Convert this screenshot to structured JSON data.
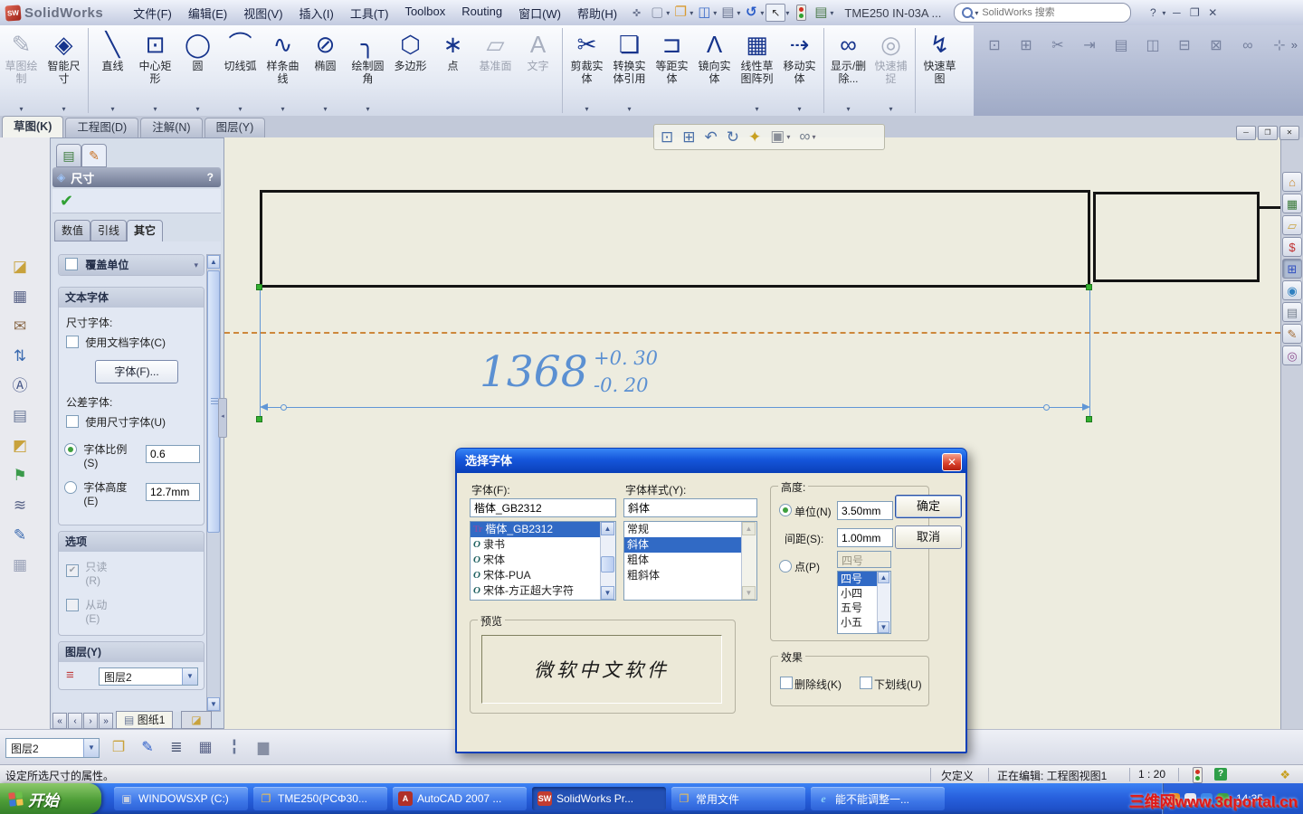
{
  "titlebar": {
    "logo_text": "SolidWorks",
    "menus": [
      "文件(F)",
      "编辑(E)",
      "视图(V)",
      "插入(I)",
      "工具(T)",
      "Toolbox",
      "Routing",
      "窗口(W)",
      "帮助(H)"
    ],
    "doc_title": "TME250 IN-03A ...",
    "search_placeholder": "SolidWorks 搜索",
    "help_label": "?"
  },
  "quickbar": {
    "new": "▢",
    "open": "❐",
    "save": "◫",
    "print": "▤",
    "undo": "↺",
    "select": "↖",
    "list": "▤"
  },
  "window_controls": {
    "minimize": "─",
    "restore": "❐",
    "close": "✕"
  },
  "toolbar": {
    "items": [
      {
        "label": "草图绘制",
        "glyph": "✎",
        "icon": "sketch-button",
        "disabled": true,
        "dd": true
      },
      {
        "label": "智能尺寸",
        "glyph": "◈",
        "icon": "smart-dimension-button",
        "dd": true
      },
      {
        "sep": true
      },
      {
        "label": "直线",
        "glyph": "╲",
        "icon": "line-button",
        "dd": true
      },
      {
        "label": "中心矩形",
        "glyph": "⊡",
        "icon": "center-rectangle-button",
        "dd": true
      },
      {
        "label": "圆",
        "glyph": "◯",
        "icon": "circle-button",
        "dd": true
      },
      {
        "label": "切线弧",
        "glyph": "⌒",
        "icon": "tangent-arc-button",
        "dd": true
      },
      {
        "label": "样条曲线",
        "glyph": "∿",
        "icon": "spline-button",
        "dd": true
      },
      {
        "label": "椭圆",
        "glyph": "⊘",
        "icon": "ellipse-button",
        "dd": true
      },
      {
        "label": "绘制圆角",
        "glyph": "╮",
        "icon": "sketch-fillet-button",
        "dd": true
      },
      {
        "label": "多边形",
        "glyph": "⬡",
        "icon": "polygon-button"
      },
      {
        "label": "点",
        "glyph": "∗",
        "icon": "point-button"
      },
      {
        "label": "基准面",
        "glyph": "▱",
        "icon": "plane-button",
        "disabled": true
      },
      {
        "label": "文字",
        "glyph": "A",
        "icon": "text-button",
        "disabled": true
      },
      {
        "sep": true
      },
      {
        "label": "剪裁实体",
        "glyph": "✂",
        "icon": "trim-entities-button",
        "dd": true
      },
      {
        "label": "转换实体引用",
        "glyph": "❏",
        "icon": "convert-entities-button",
        "dd": true
      },
      {
        "label": "等距实体",
        "glyph": "⊐",
        "icon": "offset-entities-button"
      },
      {
        "label": "镜向实体",
        "glyph": "Λ",
        "icon": "mirror-entities-button"
      },
      {
        "label": "线性草图阵列",
        "glyph": "▦",
        "icon": "linear-sketch-pattern-button",
        "dd": true
      },
      {
        "label": "移动实体",
        "glyph": "⇢",
        "icon": "move-entities-button",
        "dd": true
      },
      {
        "sep": true
      },
      {
        "label": "显示/删除...",
        "glyph": "∞",
        "icon": "display-delete-relations-button",
        "dd": true
      },
      {
        "label": "快速捕捉",
        "glyph": "◎",
        "icon": "quick-snaps-button",
        "disabled": true,
        "dd": true
      },
      {
        "sep": true
      },
      {
        "label": "快速草图",
        "glyph": "↯",
        "icon": "rapid-sketch-button",
        "color": "#C8A020"
      }
    ]
  },
  "toolbar_ext": {
    "icons": [
      {
        "glyph": "⊡",
        "name": "ext-tool-icon-1"
      },
      {
        "glyph": "⊞",
        "name": "ext-tool-icon-2"
      },
      {
        "glyph": "✂",
        "name": "ext-tool-icon-3"
      },
      {
        "glyph": "⇥",
        "name": "ext-tool-icon-4"
      },
      {
        "glyph": "▤",
        "name": "ext-tool-icon-5"
      },
      {
        "glyph": "◫",
        "name": "ext-tool-icon-6"
      },
      {
        "glyph": "⊟",
        "name": "ext-tool-icon-7"
      },
      {
        "glyph": "⊠",
        "name": "ext-tool-icon-8"
      },
      {
        "glyph": "∞",
        "name": "ext-tool-icon-9"
      },
      {
        "glyph": "⊹",
        "name": "ext-tool-icon-10"
      }
    ],
    "more": "»"
  },
  "doc_tabs": [
    {
      "label": "草图(K)",
      "active": true,
      "name": "tab-sketch"
    },
    {
      "label": "工程图(D)",
      "name": "tab-drawing"
    },
    {
      "label": "注解(N)",
      "name": "tab-annotation"
    },
    {
      "label": "图层(Y)",
      "name": "tab-layer"
    }
  ],
  "left_strip": {
    "icons": [
      {
        "glyph": "◪",
        "name": "sketch-color-icon",
        "color": "#C8A23C"
      },
      {
        "glyph": "▦",
        "name": "grid-icon",
        "color": "#5A6488"
      },
      {
        "glyph": "✉",
        "name": "stamp-icon",
        "color": "#8A6A4A"
      },
      {
        "glyph": "⇅",
        "name": "reverse-direction-icon",
        "color": "#3A6AB0"
      },
      {
        "glyph": "Ⓐ",
        "name": "spell-check-icon",
        "color": "#4A5A8A"
      },
      {
        "glyph": "▤",
        "name": "table-icon",
        "color": "#6A7898"
      },
      {
        "glyph": "◩",
        "name": "block-icon",
        "color": "#C8A23C"
      },
      {
        "glyph": "⚑",
        "name": "flag-icon",
        "color": "#3A9A4A"
      },
      {
        "glyph": "≋",
        "name": "spring-icon",
        "color": "#5A6488"
      },
      {
        "glyph": "✎",
        "name": "pen-icon",
        "color": "#3A6AB0"
      },
      {
        "glyph": "▦",
        "name": "pattern-icon",
        "color": "#9AA2B8"
      }
    ]
  },
  "panel": {
    "title": "尺寸",
    "help": "?",
    "tabs": [
      {
        "label": "数值",
        "name": "panel-tab-value"
      },
      {
        "label": "引线",
        "name": "panel-tab-leaders"
      },
      {
        "label": "其它",
        "active": true,
        "name": "panel-tab-other"
      }
    ],
    "override_units": "覆盖单位",
    "text_font_header": "文本字体",
    "dim_font_label": "尺寸字体:",
    "use_doc_font": "使用文档字体(C)",
    "font_button": "字体(F)...",
    "tol_font_label": "公差字体:",
    "use_dim_font": "使用尺寸字体(U)",
    "font_scale_label": "字体比例",
    "font_scale_key": "(S)",
    "font_scale_value": "0.6",
    "font_height_label": "字体高度",
    "font_height_key": "(E)",
    "font_height_value": "12.7mm",
    "options_header": "选项",
    "readonly_label": "只读",
    "readonly_key": "(R)",
    "driven_label": "从动",
    "driven_key": "(E)",
    "layer_header": "图层(Y)",
    "layer_value": "图层2"
  },
  "sheet": {
    "nav": [
      "«",
      "‹",
      "›",
      "»"
    ],
    "tab": "图纸1"
  },
  "drawing": {
    "dim": "1368",
    "tol_plus": "+0. 30",
    "tol_minus": "-0. 20"
  },
  "headsup": {
    "icons": [
      {
        "glyph": "⊡",
        "name": "zoom-fit-icon",
        "color": "#4A6FA8"
      },
      {
        "glyph": "⊞",
        "name": "zoom-area-icon",
        "color": "#4A6FA8"
      },
      {
        "glyph": "↶",
        "name": "previous-view-icon",
        "color": "#4A6FA8"
      },
      {
        "glyph": "↻",
        "name": "rotate-view-icon",
        "color": "#4A6FA8"
      },
      {
        "glyph": "✦",
        "name": "3d-drawing-view-icon",
        "color": "#C8A020"
      },
      {
        "glyph": "▣",
        "name": "display-style-icon",
        "color": "#8A8F98",
        "dd": true
      },
      {
        "glyph": "∞",
        "name": "hide-show-items-icon",
        "color": "#77818F",
        "dd": true
      }
    ]
  },
  "right_pane": {
    "icons": [
      {
        "glyph": "⌂",
        "name": "home-icon",
        "color": "#C8862B"
      },
      {
        "glyph": "▦",
        "name": "resources-icon",
        "color": "#3A7A3A"
      },
      {
        "glyph": "▱",
        "name": "design-library-icon",
        "color": "#C8A23C"
      },
      {
        "glyph": "$",
        "name": "toolbox-icon",
        "color": "#C03030"
      },
      {
        "glyph": "⊞",
        "name": "file-explorer-icon",
        "color": "#3050C0",
        "active": true
      },
      {
        "glyph": "◉",
        "name": "internet-icon",
        "color": "#3080C0"
      },
      {
        "glyph": "▤",
        "name": "document-icon",
        "color": "#77818F"
      },
      {
        "glyph": "✎",
        "name": "custom-properties-icon",
        "color": "#A06830"
      },
      {
        "glyph": "◎",
        "name": "search-icon",
        "color": "#905090"
      }
    ]
  },
  "dialog": {
    "title": "选择字体",
    "font_label": "字体(F):",
    "font_value": "楷体_GB2312",
    "fonts": [
      {
        "name": "楷体_GB2312",
        "type": "TT",
        "selected": true
      },
      {
        "name": "隶书",
        "type": "O"
      },
      {
        "name": "宋体",
        "type": "O"
      },
      {
        "name": "宋体-PUA",
        "type": "O"
      },
      {
        "name": "宋体-方正超大字符",
        "type": "O"
      }
    ],
    "style_label": "字体样式(Y):",
    "style_value": "斜体",
    "styles": [
      {
        "name": "常规"
      },
      {
        "name": "斜体",
        "selected": true
      },
      {
        "name": "粗体"
      },
      {
        "name": "粗斜体"
      }
    ],
    "height_group": "高度:",
    "units_label": "单位(N)",
    "units_value": "3.50mm",
    "spacing_label": "间距(S):",
    "spacing_value": "1.00mm",
    "points_label": "点(P)",
    "points_value": "四号",
    "sizes": [
      {
        "name": "四号",
        "selected": true
      },
      {
        "name": "小四"
      },
      {
        "name": "五号"
      },
      {
        "name": "小五"
      }
    ],
    "ok": "确定",
    "cancel": "取消",
    "preview_group": "预览",
    "preview_text": "微软中文软件",
    "effects_group": "效果",
    "strikeout": "删除线(K)",
    "underline": "下划线(U)"
  },
  "line_toolbar": {
    "layer_value": "图层2",
    "icons": [
      {
        "glyph": "❐",
        "name": "layer-properties-icon",
        "color": "#C8A23C"
      },
      {
        "glyph": "✎",
        "name": "line-color-icon",
        "color": "#2A5CC8"
      },
      {
        "glyph": "≣",
        "name": "line-thickness-icon",
        "color": "#44506E"
      },
      {
        "glyph": "▦",
        "name": "line-style-icon",
        "color": "#5A6488"
      },
      {
        "glyph": "╏",
        "name": "hide-show-edges-icon",
        "color": "#6A7898"
      },
      {
        "glyph": "▆",
        "name": "color-display-mode-icon",
        "color": "#8890A4"
      }
    ]
  },
  "statusbar": {
    "message": "设定所选尺寸的属性。",
    "state": "欠定义",
    "editing": "正在编辑: 工程图视图1",
    "scale": "1 : 20",
    "help_glyph": "?"
  },
  "taskbar": {
    "start": "开始",
    "tasks": [
      {
        "label": "WINDOWSXP (C:)"
      },
      {
        "label": "TME250(PCΦ30..."
      },
      {
        "label": "AutoCAD 2007 ..."
      },
      {
        "label": "SolidWorks Pr...",
        "active": true
      },
      {
        "label": "常用文件"
      },
      {
        "label": "能不能调整一..."
      }
    ],
    "time": "14:35",
    "watermark": "三维网www.3dportal.cn"
  },
  "colors": {
    "dimension_blue": "#5B90D2",
    "centerline_orange": "#CD873B",
    "selection_blue": "#316AC5",
    "taskbar_blue": "#2861DE",
    "start_green": "#4E9E38",
    "watermark_red": "#E01818",
    "sheet_beige": "#EDECDF"
  }
}
